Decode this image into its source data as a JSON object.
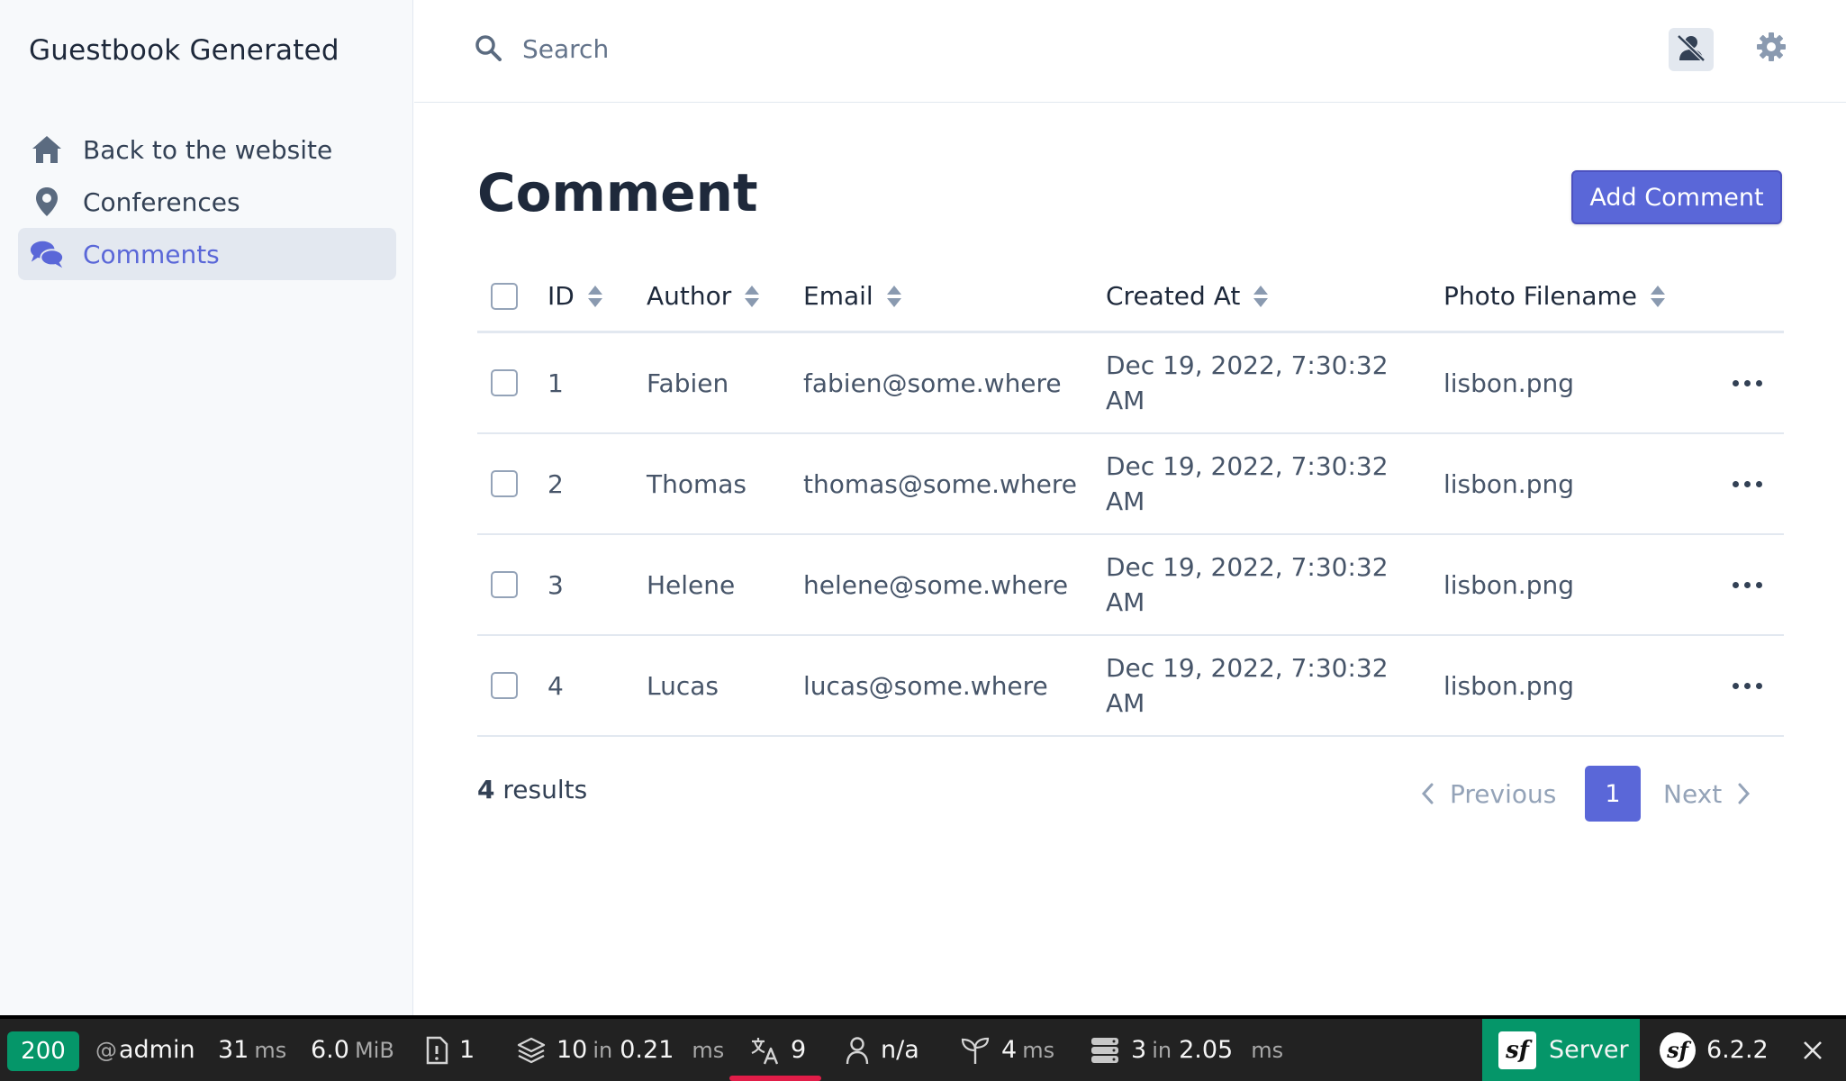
{
  "brand": "Guestbook Generated",
  "sidebar": {
    "items": [
      {
        "label": "Back to the website",
        "icon": "home-icon"
      },
      {
        "label": "Conferences",
        "icon": "map-marker-icon"
      },
      {
        "label": "Comments",
        "icon": "comments-icon",
        "active": true
      }
    ]
  },
  "topbar": {
    "search_placeholder": "Search",
    "search_value": ""
  },
  "page": {
    "title": "Comment",
    "add_button": "Add Comment"
  },
  "table": {
    "columns": [
      "ID",
      "Author",
      "Email",
      "Created At",
      "Photo Filename"
    ],
    "rows": [
      {
        "id": "1",
        "author": "Fabien",
        "email": "fabien@some.where",
        "created_at": "Dec 19, 2022, 7:30:32 AM",
        "photo": "lisbon.png"
      },
      {
        "id": "2",
        "author": "Thomas",
        "email": "thomas@some.where",
        "created_at": "Dec 19, 2022, 7:30:32 AM",
        "photo": "lisbon.png"
      },
      {
        "id": "3",
        "author": "Helene",
        "email": "helene@some.where",
        "created_at": "Dec 19, 2022, 7:30:32 AM",
        "photo": "lisbon.png"
      },
      {
        "id": "4",
        "author": "Lucas",
        "email": "lucas@some.where",
        "created_at": "Dec 19, 2022, 7:30:32 AM",
        "photo": "lisbon.png"
      }
    ]
  },
  "pagination": {
    "count": "4",
    "results_label": "results",
    "previous": "Previous",
    "next": "Next",
    "current_page": "1"
  },
  "toolbar": {
    "status_code": "200",
    "at": "@",
    "user": "admin",
    "time_value": "31",
    "time_unit": "ms",
    "memory_value": "6.0",
    "memory_unit": "MiB",
    "logs_count": "1",
    "twig_count": "10",
    "twig_in": "in",
    "twig_time": "0.21",
    "twig_unit": "ms",
    "translation_count": "9",
    "security_user": "n/a",
    "events_value": "4",
    "events_unit": "ms",
    "db_queries": "3",
    "db_in": "in",
    "db_time": "2.05",
    "db_unit": "ms",
    "server_label": "Server",
    "version": "6.2.2",
    "symfony_glyph": "sf"
  },
  "colors": {
    "accent": "#5a67d8",
    "status_ok": "#059669",
    "toolbar_bg": "#222222"
  }
}
